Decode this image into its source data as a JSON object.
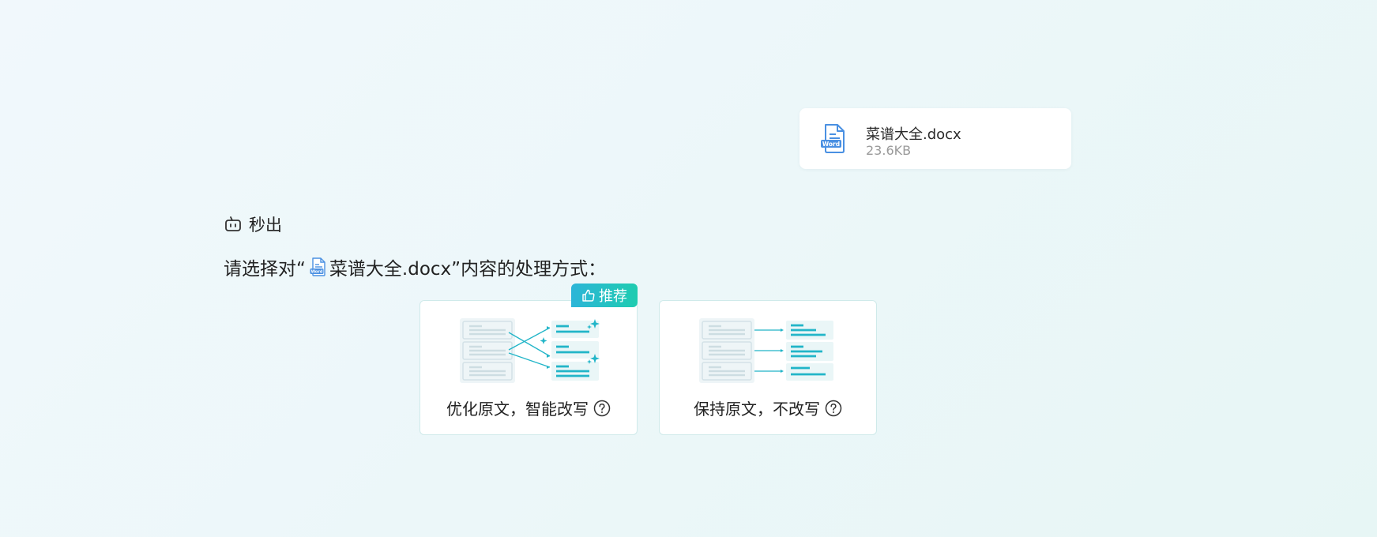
{
  "uploaded_file": {
    "name": "菜谱大全.docx",
    "size": "23.6KB",
    "icon": "word-document-icon"
  },
  "assistant": {
    "name": "秒出",
    "icon": "robot-icon"
  },
  "prompt": {
    "prefix": "请选择对“",
    "file_name": "菜谱大全.docx",
    "suffix": "”内容的处理方式："
  },
  "options": [
    {
      "label": "优化原文，智能改写",
      "badge": "推荐",
      "icon": "help-circle-icon"
    },
    {
      "label": "保持原文，不改写",
      "icon": "help-circle-icon"
    }
  ],
  "colors": {
    "accent_start": "#2cb5d8",
    "accent_end": "#1fccb0",
    "word_blue": "#4a90e2",
    "card_border": "#cfeaea"
  }
}
